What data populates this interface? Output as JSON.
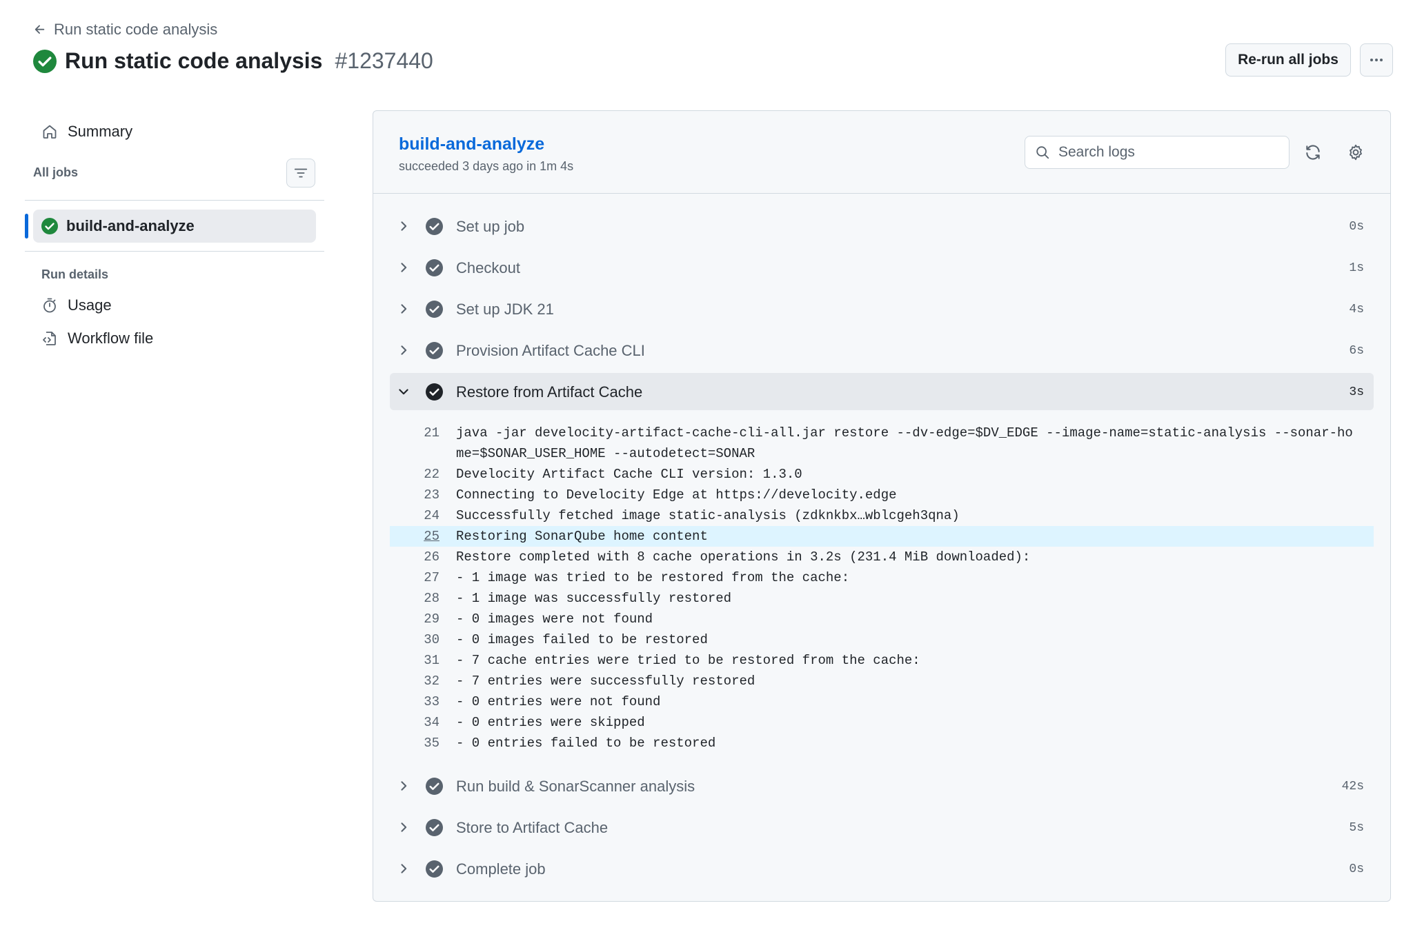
{
  "header": {
    "back_label": "Run static code analysis",
    "title": "Run static code analysis",
    "run_number": "#1237440",
    "rerun_label": "Re-run all jobs"
  },
  "sidebar": {
    "summary_label": "Summary",
    "all_jobs_label": "All jobs",
    "job_label": "build-and-analyze",
    "run_details_label": "Run details",
    "usage_label": "Usage",
    "workflow_label": "Workflow file"
  },
  "job": {
    "title": "build-and-analyze",
    "subtitle": "succeeded 3 days ago in 1m 4s",
    "search_placeholder": "Search logs"
  },
  "steps": [
    {
      "label": "Set up job",
      "time": "0s"
    },
    {
      "label": "Checkout",
      "time": "1s"
    },
    {
      "label": "Set up JDK 21",
      "time": "4s"
    },
    {
      "label": "Provision Artifact Cache CLI",
      "time": "6s"
    },
    {
      "label": "Restore from Artifact Cache",
      "time": "3s"
    },
    {
      "label": "Run build & SonarScanner analysis",
      "time": "42s"
    },
    {
      "label": "Store to Artifact Cache",
      "time": "5s"
    },
    {
      "label": "Complete job",
      "time": "0s"
    }
  ],
  "log_lines": [
    {
      "n": "21",
      "t": "java -jar develocity-artifact-cache-cli-all.jar restore --dv-edge=$DV_EDGE --image-name=static-analysis --sonar-home=$SONAR_USER_HOME --autodetect=SONAR"
    },
    {
      "n": "22",
      "t": "Develocity Artifact Cache CLI version: 1.3.0"
    },
    {
      "n": "23",
      "t": "Connecting to Develocity Edge at https://develocity.edge"
    },
    {
      "n": "24",
      "t": "Successfully fetched image static-analysis (zdknkbx…wblcgeh3qna)"
    },
    {
      "n": "25",
      "t": "Restoring SonarQube home content"
    },
    {
      "n": "26",
      "t": "Restore completed with 8 cache operations in 3.2s (231.4 MiB downloaded):"
    },
    {
      "n": "27",
      "t": "- 1 image was tried to be restored from the cache:"
    },
    {
      "n": "28",
      "t": "- 1 image was successfully restored"
    },
    {
      "n": "29",
      "t": "- 0 images were not found"
    },
    {
      "n": "30",
      "t": "- 0 images failed to be restored"
    },
    {
      "n": "31",
      "t": "- 7 cache entries were tried to be restored from the cache:"
    },
    {
      "n": "32",
      "t": "- 7 entries were successfully restored"
    },
    {
      "n": "33",
      "t": "- 0 entries were not found"
    },
    {
      "n": "34",
      "t": "- 0 entries were skipped"
    },
    {
      "n": "35",
      "t": "- 0 entries failed to be restored"
    }
  ],
  "icons": {
    "back": "arrow-left-icon",
    "status": "check-circle-icon",
    "more": "kebab-horizontal-icon",
    "summary": "home-icon",
    "filter": "filter-icon",
    "usage": "stopwatch-icon",
    "workflow": "file-code-icon",
    "search": "search-icon",
    "refresh": "sync-icon",
    "settings": "gear-icon",
    "chevron": "chevron-right-icon",
    "chevron_open": "chevron-down-icon"
  },
  "colors": {
    "success": "#1f883d",
    "accent": "#0969da",
    "step_check": "#59636e"
  }
}
